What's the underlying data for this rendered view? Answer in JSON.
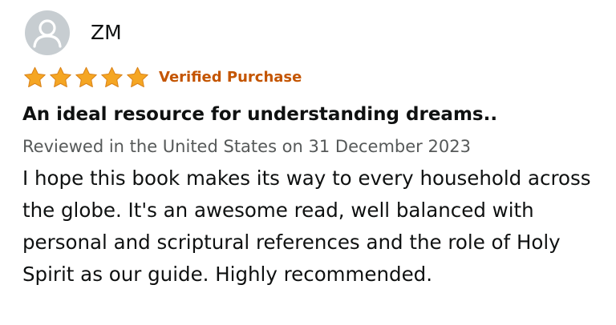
{
  "reviewer": {
    "name": "ZM",
    "avatar_icon": "default-profile-icon"
  },
  "rating": {
    "stars": 5,
    "max_stars": 5,
    "star_color": "#f5a623",
    "star_icon": "star-icon"
  },
  "verified_label": "Verified Purchase",
  "verified_color": "#c45500",
  "review": {
    "title": "An ideal resource for understanding dreams..",
    "date_line": "Reviewed in the United States on 31 December 2023",
    "body": "I hope this book makes its way to every household across the globe. It's an awesome read, well balanced with personal and scriptural references and the role of Holy Spirit as our guide. Highly recommended."
  }
}
